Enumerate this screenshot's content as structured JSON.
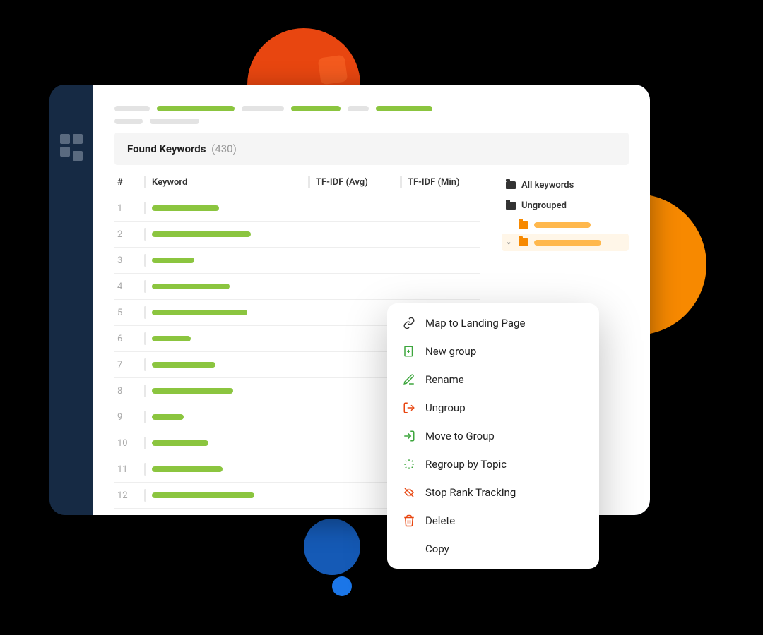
{
  "section": {
    "title": "Found Keywords",
    "count": "(430)"
  },
  "table": {
    "headers": {
      "num": "#",
      "keyword": "Keyword",
      "avg": "TF-IDF (Avg)",
      "min": "TF-IDF (Min)"
    },
    "rows": [
      {
        "n": "1",
        "kw_w": 95,
        "avg_w": 55,
        "min_w": 40
      },
      {
        "n": "2",
        "kw_w": 140,
        "avg_w": 55,
        "min_w": 35
      },
      {
        "n": "3",
        "kw_w": 60,
        "avg_w": 70,
        "min_w": 18
      },
      {
        "n": "4",
        "kw_w": 110,
        "avg_w": 85,
        "min_w": 0
      },
      {
        "n": "5",
        "kw_w": 135,
        "avg_w": 60,
        "min_w": 0
      },
      {
        "n": "6",
        "kw_w": 55,
        "avg_w": 80,
        "min_w": 0
      },
      {
        "n": "7",
        "kw_w": 90,
        "avg_w": 95,
        "min_w": 0
      },
      {
        "n": "8",
        "kw_w": 115,
        "avg_w": 70,
        "min_w": 0
      },
      {
        "n": "9",
        "kw_w": 45,
        "avg_w": 0,
        "min_w": 0
      },
      {
        "n": "10",
        "kw_w": 80,
        "avg_w": 0,
        "min_w": 0
      },
      {
        "n": "11",
        "kw_w": 100,
        "avg_w": 0,
        "min_w": 0
      },
      {
        "n": "12",
        "kw_w": 145,
        "avg_w": 0,
        "min_w": 0
      }
    ]
  },
  "filters": {
    "all": "All keywords",
    "ungrouped": "Ungrouped"
  },
  "menu": {
    "map": "Map to Landing Page",
    "new_group": "New group",
    "rename": "Rename",
    "ungroup": "Ungroup",
    "move": "Move to Group",
    "regroup": "Regroup by Topic",
    "stop": "Stop Rank Tracking",
    "delete": "Delete",
    "copy": "Copy"
  },
  "colors": {
    "green": "#8BC53F",
    "orange": "#F78900",
    "red": "#E84610",
    "blue": "#1B76E8",
    "dark": "#162A44"
  }
}
